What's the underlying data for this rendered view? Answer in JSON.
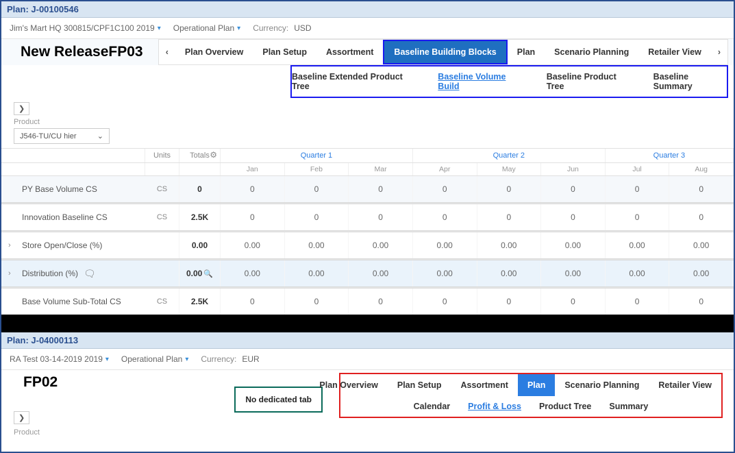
{
  "top": {
    "title": "Plan: J-00100546",
    "org": "Jim's Mart HQ 300815/CPF1C100  2019",
    "plan_type": "Operational Plan",
    "currency_label": "Currency:",
    "currency_value": "USD",
    "release_label": "New ReleaseFP03",
    "main_tabs": {
      "prev": "‹",
      "items": [
        "Plan Overview",
        "Plan Setup",
        "Assortment",
        "Baseline Building Blocks",
        "Plan",
        "Scenario Planning",
        "Retailer View"
      ],
      "next": "›"
    },
    "sub_tabs": [
      "Baseline Extended Product Tree",
      "Baseline Volume Build",
      "Baseline Product Tree",
      "Baseline Summary"
    ],
    "product_label": "Product",
    "product_value": "J546-TU/CU hier",
    "grid": {
      "units_hdr": "Units",
      "totals_hdr": "Totals",
      "quarters": [
        "Quarter 1",
        "Quarter 2",
        "Quarter 3"
      ],
      "months": [
        "Jan",
        "Feb",
        "Mar",
        "Apr",
        "May",
        "Jun",
        "Jul",
        "Aug"
      ],
      "rows": [
        {
          "label": "PY Base Volume  CS",
          "units": "CS",
          "total": "0",
          "cells": [
            "0",
            "0",
            "0",
            "0",
            "0",
            "0",
            "0",
            "0"
          ]
        },
        {
          "label": "Innovation Baseline    CS",
          "units": "CS",
          "total": "2.5K",
          "cells": [
            "0",
            "0",
            "0",
            "0",
            "0",
            "0",
            "0",
            "0"
          ]
        },
        {
          "label": "Store Open/Close (%)",
          "units": "",
          "total": "0.00",
          "cells": [
            "0.00",
            "0.00",
            "0.00",
            "0.00",
            "0.00",
            "0.00",
            "0.00",
            "0.00"
          ]
        },
        {
          "label": "Distribution (%)",
          "units": "",
          "total": "0.00",
          "cells": [
            "0.00",
            "0.00",
            "0.00",
            "0.00",
            "0.00",
            "0.00",
            "0.00",
            "0.00"
          ],
          "comment": true,
          "zoom": true
        },
        {
          "label": "Base Volume Sub-Total  CS",
          "units": "CS",
          "total": "2.5K",
          "cells": [
            "0",
            "0",
            "0",
            "0",
            "0",
            "0",
            "0",
            "0"
          ]
        }
      ]
    }
  },
  "bottom": {
    "title": "Plan: J-04000113",
    "org": "RA Test 03-14-2019  2019",
    "plan_type": "Operational Plan",
    "currency_label": "Currency:",
    "currency_value": "EUR",
    "release_label": "FP02",
    "main_tabs": {
      "items": [
        "Plan Overview",
        "Plan Setup",
        "Assortment",
        "Plan",
        "Scenario Planning",
        "Retailer View"
      ]
    },
    "sub_tabs": [
      "Calendar",
      "Profit & Loss",
      "Product Tree",
      "Summary"
    ],
    "callout": "No dedicated tab",
    "product_label": "Product"
  }
}
